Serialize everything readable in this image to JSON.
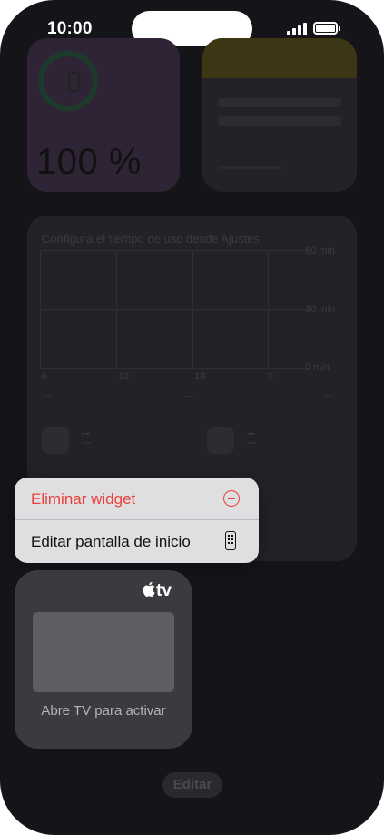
{
  "status_bar": {
    "time": "10:00"
  },
  "widgets": {
    "battery": {
      "percentage": "100 %",
      "accent": "#2e2436"
    },
    "notes": {
      "accent": "#3d3615"
    },
    "screen_time": {
      "caption": "Configura el tiempo de uso desde Ajustes.",
      "y_labels": [
        "60 min",
        "30 min",
        "0 min"
      ],
      "x_labels": [
        "6",
        "12",
        "18",
        "0"
      ],
      "totals": [
        "--",
        "--",
        "--"
      ],
      "apps": [
        {
          "value": "--",
          "sub": "--"
        },
        {
          "value": "--",
          "sub": "--"
        }
      ]
    },
    "apple_tv": {
      "logo": "tv",
      "caption": "Abre TV para activar"
    }
  },
  "context_menu": {
    "items": [
      {
        "label": "Eliminar widget",
        "icon": "minus-circle-icon",
        "color": "#e9413a"
      },
      {
        "label": "Editar pantalla de inicio",
        "icon": "home-screen-icon",
        "color": "#111111"
      }
    ]
  },
  "edit_button": {
    "label": "Editar"
  }
}
